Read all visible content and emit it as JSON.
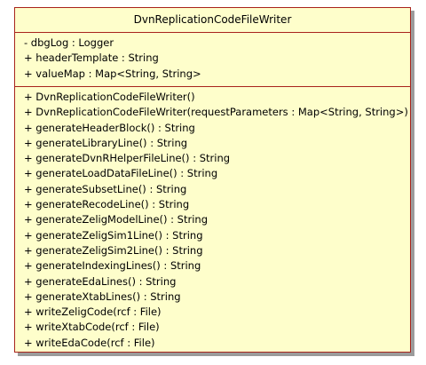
{
  "class": {
    "name": "DvnReplicationCodeFileWriter",
    "attributes": [
      "- dbgLog : Logger",
      "+ headerTemplate : String",
      "+ valueMap : Map<String, String>"
    ],
    "operations": [
      "+ DvnReplicationCodeFileWriter()",
      "+ DvnReplicationCodeFileWriter(requestParameters : Map<String, String>)",
      "+ generateHeaderBlock() : String",
      "+ generateLibraryLine() : String",
      "+ generateDvnRHelperFileLine() : String",
      "+ generateLoadDataFileLine() : String",
      "+ generateSubsetLine() : String",
      "+ generateRecodeLine() : String",
      "+ generateZeligModelLine() : String",
      "+ generateZeligSim1Line() : String",
      "+ generateZeligSim2Line() : String",
      "+ generateIndexingLines() : String",
      "+ generateEdaLines() : String",
      "+ generateXtabLines() : String",
      "+ writeZeligCode(rcf : File)",
      "+ writeXtabCode(rcf : File)",
      "+ writeEdaCode(rcf : File)"
    ]
  },
  "colors": {
    "fill": "#fefecb",
    "border": "#a8241c",
    "shadow": "#9b9b9b",
    "text": "#000000"
  }
}
